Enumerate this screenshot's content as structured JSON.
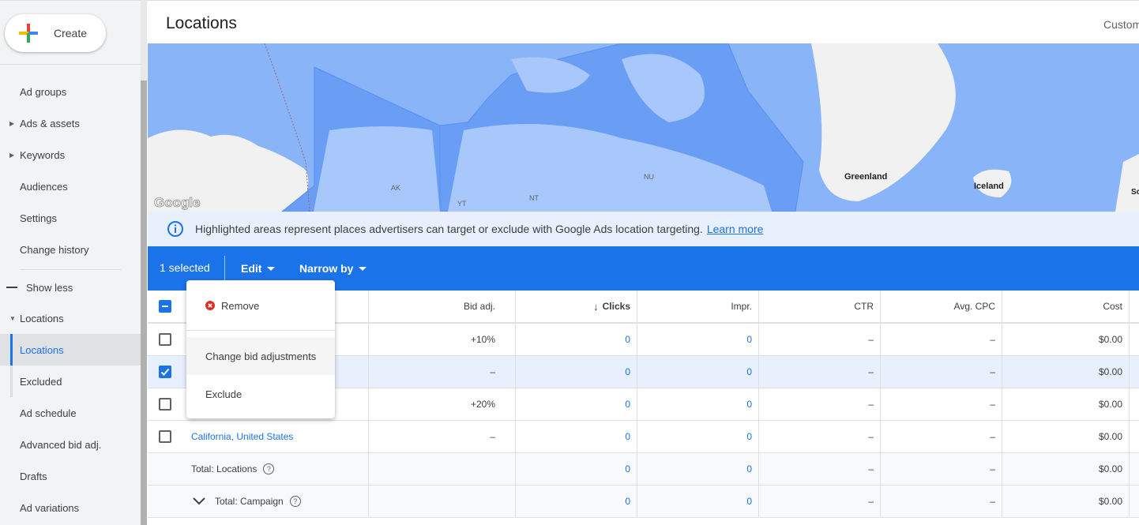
{
  "sidebar": {
    "create_label": "Create",
    "items": [
      {
        "label": "Ad groups",
        "expandable": false
      },
      {
        "label": "Ads & assets",
        "expandable": true
      },
      {
        "label": "Keywords",
        "expandable": true
      },
      {
        "label": "Audiences",
        "expandable": false
      },
      {
        "label": "Settings",
        "expandable": false
      },
      {
        "label": "Change history",
        "expandable": false
      }
    ],
    "show_less": "Show less",
    "group": {
      "label": "Locations",
      "items": [
        {
          "label": "Locations",
          "active": true
        },
        {
          "label": "Excluded"
        }
      ]
    },
    "more": [
      "Ad schedule",
      "Advanced bid adj.",
      "Drafts",
      "Ad variations"
    ]
  },
  "header": {
    "title": "Locations",
    "right_action": "Customize"
  },
  "map": {
    "labels": [
      "Greenland",
      "Iceland",
      "AK",
      "YT",
      "NT",
      "NU",
      "Sc"
    ],
    "logo": "Google"
  },
  "info": {
    "text": "Highlighted areas represent places advertisers can target or exclude with Google Ads location targeting.",
    "link": "Learn more"
  },
  "selection_bar": {
    "count": "1 selected",
    "edit": "Edit",
    "narrow": "Narrow by"
  },
  "menu": {
    "items": [
      "Remove",
      "Change bid adjustments",
      "Exclude"
    ]
  },
  "table": {
    "columns": [
      "Bid adj.",
      "Clicks",
      "Impr.",
      "CTR",
      "Avg. CPC",
      "Cost"
    ],
    "rows": [
      {
        "name": "",
        "checked": false,
        "bid": "+10%",
        "clicks": "0",
        "impr": "0",
        "ctr": "–",
        "cpc": "–",
        "cost": "$0.00"
      },
      {
        "name": "",
        "checked": true,
        "bid": "–",
        "clicks": "0",
        "impr": "0",
        "ctr": "–",
        "cpc": "–",
        "cost": "$0.00"
      },
      {
        "name": "",
        "checked": false,
        "bid": "+20%",
        "clicks": "0",
        "impr": "0",
        "ctr": "–",
        "cpc": "–",
        "cost": "$0.00"
      },
      {
        "name": "California, United States",
        "checked": false,
        "bid": "–",
        "clicks": "0",
        "impr": "0",
        "ctr": "–",
        "cpc": "–",
        "cost": "$0.00"
      }
    ],
    "totals": [
      {
        "name": "Total: Locations",
        "clicks": "0",
        "impr": "0",
        "ctr": "–",
        "cpc": "–",
        "cost": "$0.00"
      },
      {
        "name": "Total: Campaign",
        "clicks": "0",
        "impr": "0",
        "ctr": "–",
        "cpc": "–",
        "cost": "$0.00"
      }
    ]
  },
  "colors": {
    "accent": "#1a73e8",
    "map_water": "#8ab4f8",
    "map_target": "#6a9ef5",
    "remove": "#d93025"
  }
}
